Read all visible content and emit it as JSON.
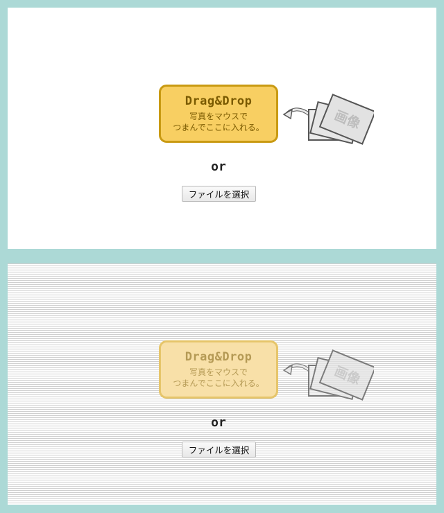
{
  "upload_area": {
    "title": "Drag&Drop",
    "instruction_line1": "写真をマウスで",
    "instruction_line2": "つまんでここに入れる。",
    "image_card_label": "画像",
    "or_label": "or",
    "choose_file_label": "ファイルを選択"
  },
  "colors": {
    "background": "#acd9d6",
    "drop_box_fill": "#f8cf62",
    "drop_box_border": "#c99a12",
    "drop_text": "#7a5a00"
  }
}
